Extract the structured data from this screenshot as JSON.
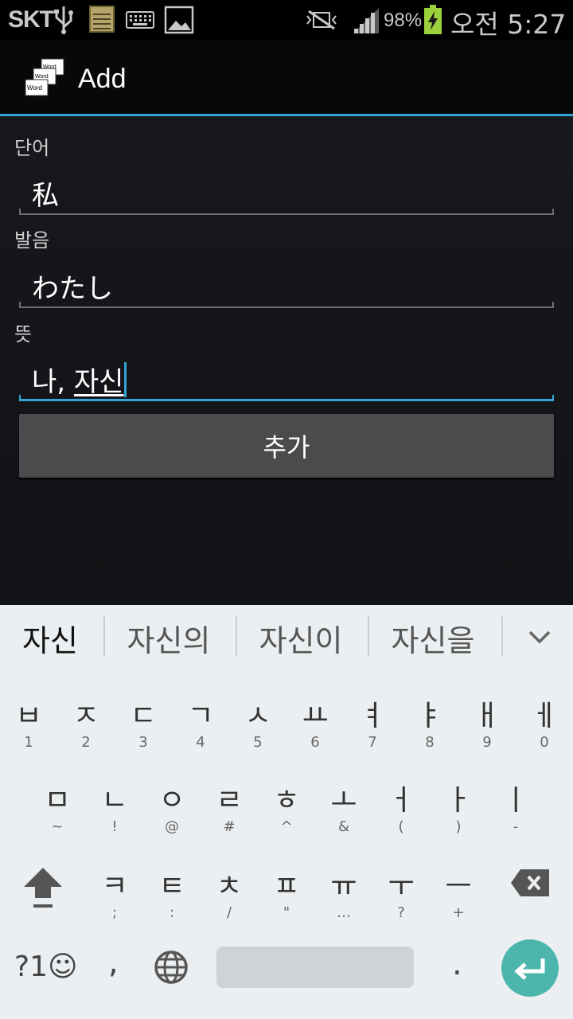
{
  "status_bar": {
    "carrier": "SKT",
    "battery_percent": "98%",
    "clock": "오전 5:27",
    "icons": [
      "usb-icon",
      "notes-icon",
      "keyboard-icon",
      "image-icon",
      "mute-icon",
      "signal-icon",
      "battery-charging-icon"
    ]
  },
  "action_bar": {
    "title": "Add",
    "app_icon": "word-cards-icon",
    "app_icon_words": [
      "Word",
      "Word",
      "Word"
    ]
  },
  "form": {
    "word": {
      "label": "단어",
      "value": "私"
    },
    "pronunciation": {
      "label": "발음",
      "value": "わたし"
    },
    "meaning": {
      "label": "뜻",
      "value_committed": "나, ",
      "value_composing": "자신"
    },
    "submit_label": "추가"
  },
  "suggestions": [
    "자신",
    "자신의",
    "자신이",
    "자신을"
  ],
  "keyboard": {
    "row1": [
      {
        "main": "ㅂ",
        "sub": "1"
      },
      {
        "main": "ㅈ",
        "sub": "2"
      },
      {
        "main": "ㄷ",
        "sub": "3"
      },
      {
        "main": "ㄱ",
        "sub": "4"
      },
      {
        "main": "ㅅ",
        "sub": "5"
      },
      {
        "main": "ㅛ",
        "sub": "6"
      },
      {
        "main": "ㅕ",
        "sub": "7"
      },
      {
        "main": "ㅑ",
        "sub": "8"
      },
      {
        "main": "ㅐ",
        "sub": "9"
      },
      {
        "main": "ㅔ",
        "sub": "0"
      }
    ],
    "row2": [
      {
        "main": "ㅁ",
        "sub": "~"
      },
      {
        "main": "ㄴ",
        "sub": "!"
      },
      {
        "main": "ㅇ",
        "sub": "@"
      },
      {
        "main": "ㄹ",
        "sub": "#"
      },
      {
        "main": "ㅎ",
        "sub": "^"
      },
      {
        "main": "ㅗ",
        "sub": "&"
      },
      {
        "main": "ㅓ",
        "sub": "("
      },
      {
        "main": "ㅏ",
        "sub": ")"
      },
      {
        "main": "ㅣ",
        "sub": "-"
      }
    ],
    "row3": [
      {
        "main": "ㅋ",
        "sub": ";"
      },
      {
        "main": "ㅌ",
        "sub": ":"
      },
      {
        "main": "ㅊ",
        "sub": "/"
      },
      {
        "main": "ㅍ",
        "sub": "\""
      },
      {
        "main": "ㅠ",
        "sub": "…"
      },
      {
        "main": "ㅜ",
        "sub": "?"
      },
      {
        "main": "ㅡ",
        "sub": "+"
      }
    ],
    "symbols_label": "?1☺",
    "comma_label": ",",
    "period_label": ".",
    "accent_color": "#4db6ac"
  }
}
